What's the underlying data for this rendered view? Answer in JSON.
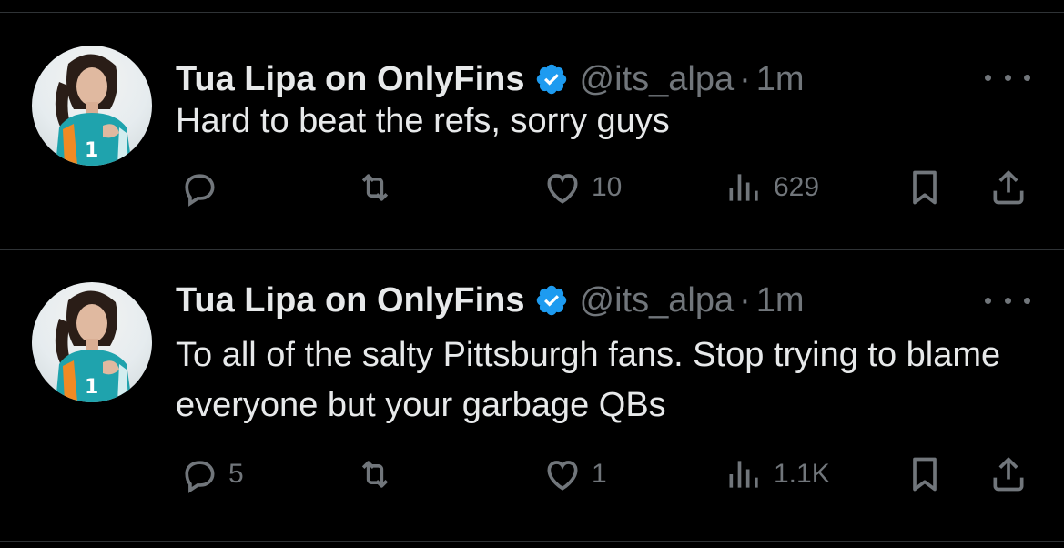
{
  "tweets": [
    {
      "author_name": "Tua Lipa on OnlyFins",
      "handle": "@its_alpa",
      "separator": "·",
      "time": "1m",
      "text": "Hard to beat the refs, sorry guys",
      "replies": "",
      "retweets": "",
      "likes": "10",
      "views": "629"
    },
    {
      "author_name": "Tua Lipa on OnlyFins",
      "handle": "@its_alpa",
      "separator": "·",
      "time": "1m",
      "text": "To all of the salty Pittsburgh fans. Stop trying to blame everyone but your garbage QBs",
      "replies": "5",
      "retweets": "",
      "likes": "1",
      "views": "1.1K"
    }
  ],
  "icons": {
    "reply": "reply-icon",
    "retweet": "retweet-icon",
    "like": "heart-icon",
    "views": "views-icon",
    "bookmark": "bookmark-icon",
    "share": "share-icon",
    "verified": "verified-badge-icon",
    "more": "more-options-icon"
  },
  "colors": {
    "background": "#000000",
    "primary_text": "#e7e9ea",
    "secondary_text": "#71767b",
    "verified_blue": "#1d9bf0",
    "divider": "#2f3336"
  }
}
